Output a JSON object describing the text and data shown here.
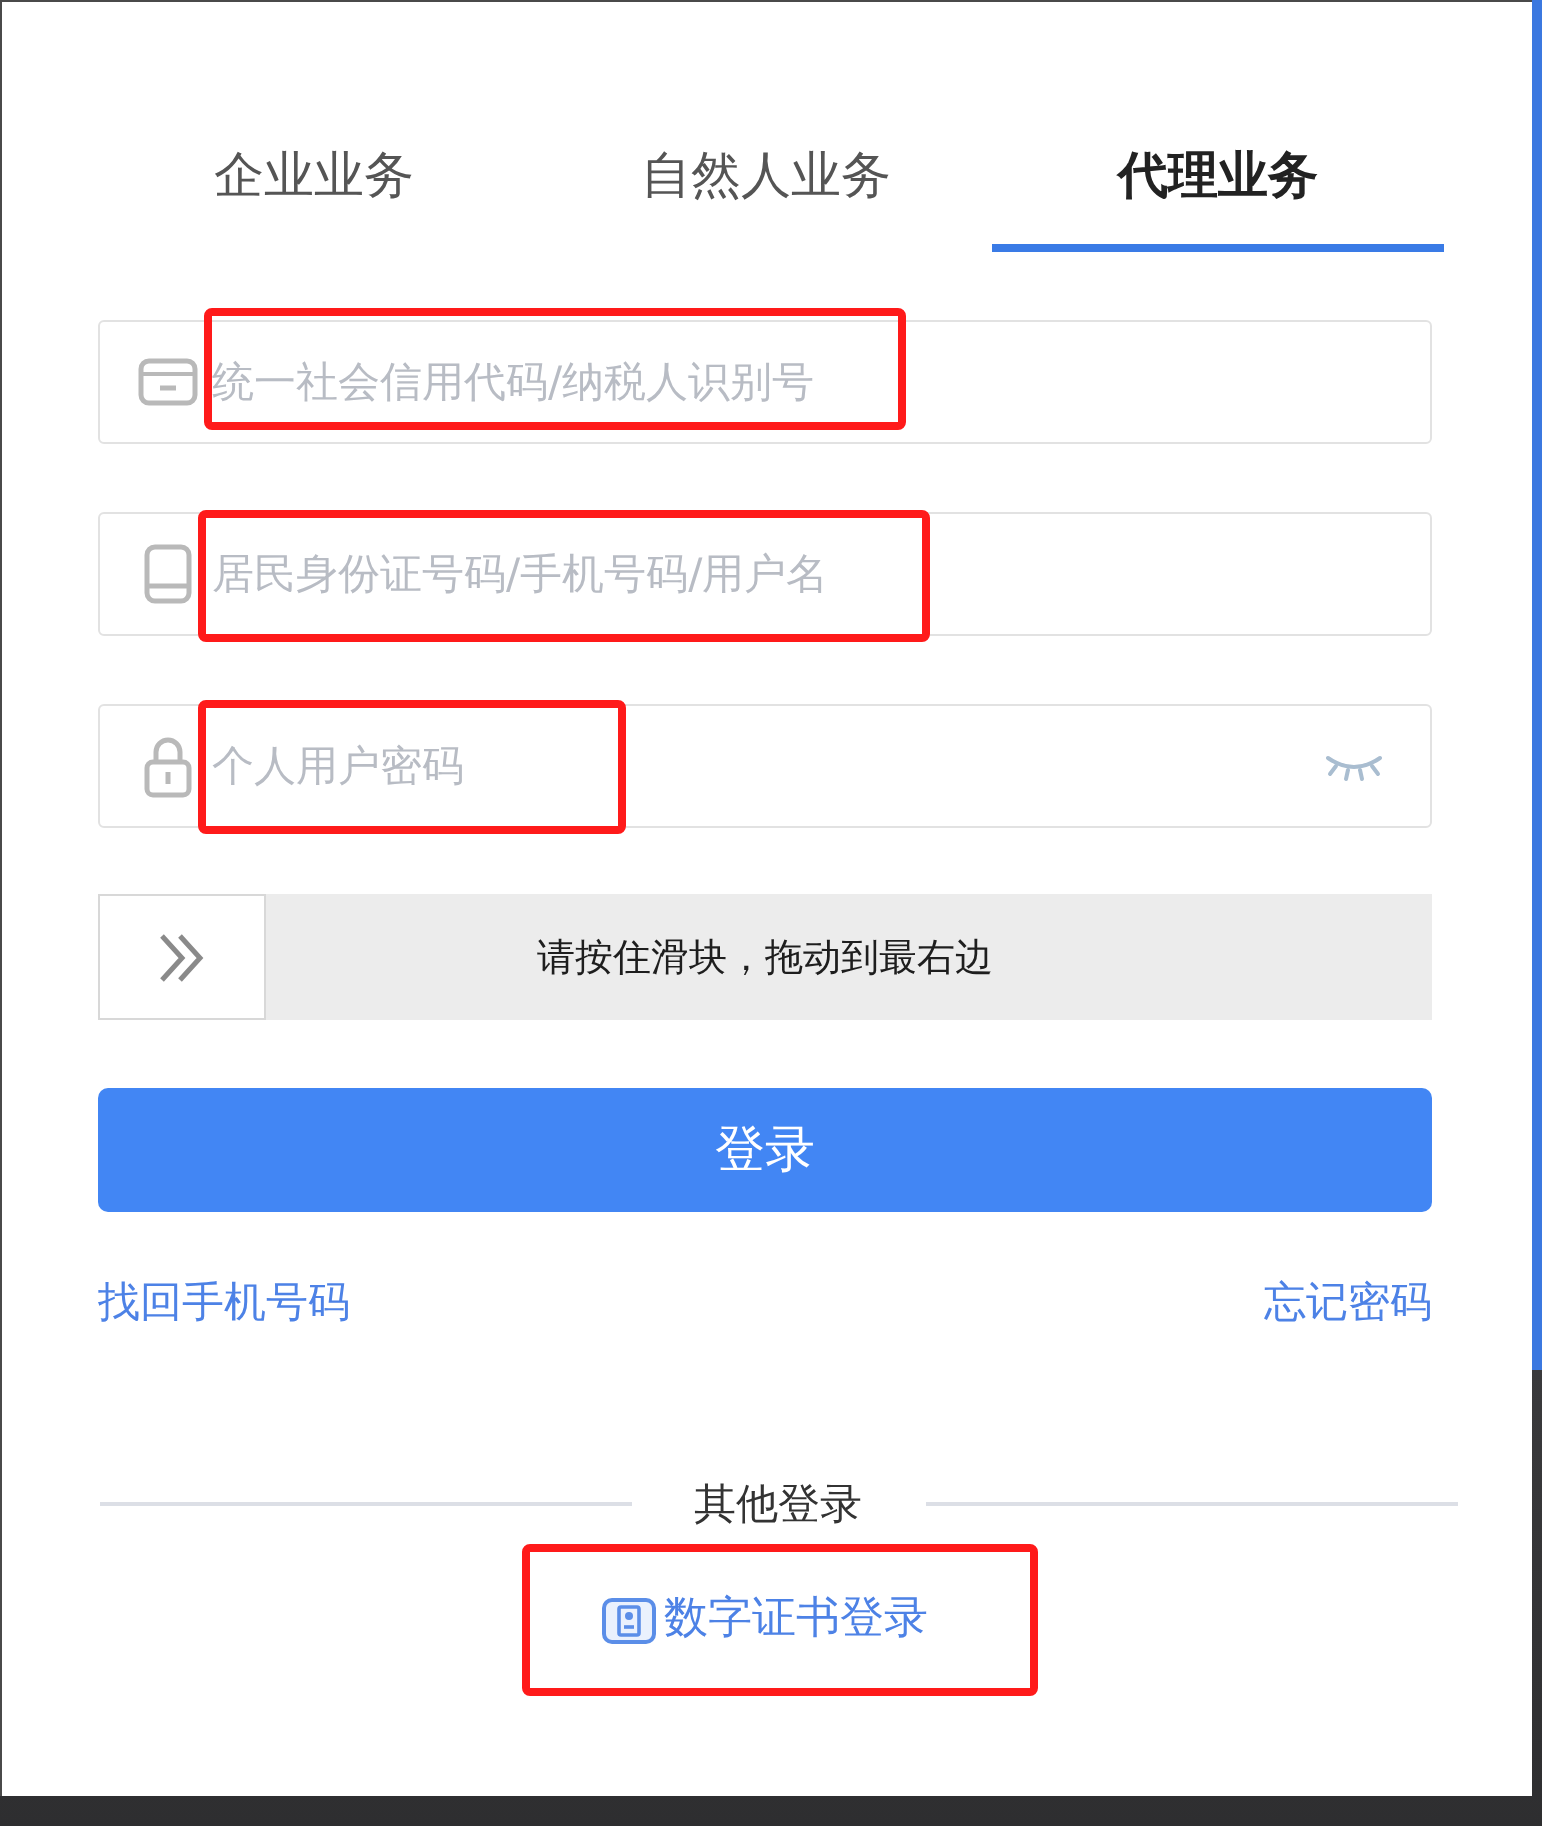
{
  "tabs": [
    {
      "label": "企业业务",
      "selected": false
    },
    {
      "label": "自然人业务",
      "selected": false
    },
    {
      "label": "代理业务",
      "selected": true
    }
  ],
  "fields": [
    {
      "kind": "credit-code",
      "placeholder": "统一社会信用代码/纳税人识别号",
      "highlighted": true
    },
    {
      "kind": "account",
      "placeholder": "居民身份证号码/手机号码/用户名",
      "highlighted": true
    },
    {
      "kind": "password",
      "placeholder": "个人用户密码",
      "highlighted": true
    }
  ],
  "slider": {
    "hint": "请按住滑块，拖动到最右边",
    "level": 0
  },
  "login_button": "登录",
  "links": [
    {
      "label": "找回手机号码"
    },
    {
      "label": "忘记密码"
    }
  ],
  "other_login": {
    "heading": "其他登录",
    "certificate_login": {
      "label": "数字证书登录",
      "highlighted": true
    }
  }
}
